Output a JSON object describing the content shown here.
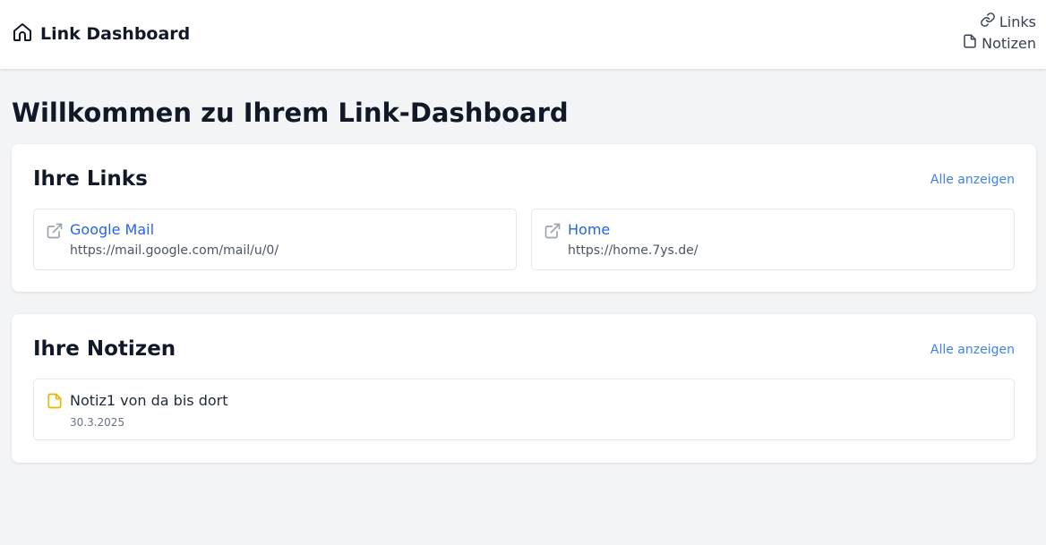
{
  "header": {
    "brand_title": "Link Dashboard",
    "brand_icon": "home-icon",
    "nav": [
      {
        "label": "Links",
        "icon": "link-icon"
      },
      {
        "label": "Notizen",
        "icon": "file-icon"
      }
    ]
  },
  "main": {
    "title": "Willkommen zu Ihrem Link-Dashboard",
    "links_section": {
      "title": "Ihre Links",
      "show_all": "Alle anzeigen",
      "items": [
        {
          "name": "Google Mail",
          "url": "https://mail.google.com/mail/u/0/",
          "icon": "external-link-icon"
        },
        {
          "name": "Home",
          "url": "https://home.7ys.de/",
          "icon": "external-link-icon"
        }
      ]
    },
    "notes_section": {
      "title": "Ihre Notizen",
      "show_all": "Alle anzeigen",
      "items": [
        {
          "title": "Notiz1 von da bis dort",
          "date": "30.3.2025",
          "icon": "file-icon"
        }
      ]
    }
  },
  "colors": {
    "accent": "#2563eb",
    "link_muted": "#3b82f6",
    "note_icon": "#eab308",
    "background": "#f3f4f6"
  }
}
